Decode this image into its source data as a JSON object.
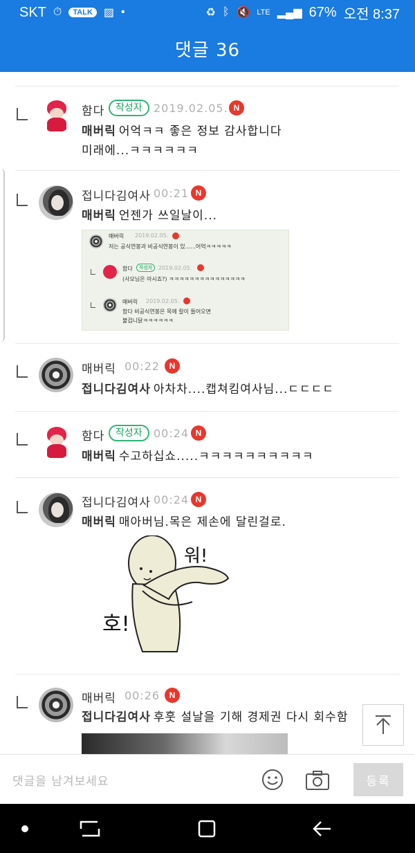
{
  "status_bar": {
    "carrier": "SKT",
    "talk_label": "TALK",
    "network": "LTE",
    "battery": "67%",
    "time": "오전 8:37"
  },
  "header": {
    "title": "댓글 36"
  },
  "comments": [
    {
      "author": "함다",
      "badge": "작성자",
      "time": "2019.02.05.",
      "new_label": "N",
      "mention": "매버릭",
      "text_line1": "어억ㅋㅋ 좋은 정보 감사합니다",
      "text_line2": "미래에...ㅋㅋㅋㅋㅋㅋ"
    },
    {
      "author": "접니다김여사",
      "time": "00:21",
      "new_label": "N",
      "mention": "매버릭",
      "text_line1": "언젠가 쓰일날이..."
    },
    {
      "author": "매버릭",
      "time": "00:22",
      "new_label": "N",
      "mention": "접니다김여사",
      "text_line1": "아차차....캡쳐킴여사님...ㄷㄷㄷㄷ"
    },
    {
      "author": "함다",
      "badge": "작성자",
      "time": "00:24",
      "new_label": "N",
      "mention": "매버릭",
      "text_line1": "수고하십쇼.....ㅋㅋㅋㅋㅋㅋㅋㅋㅋㅋ"
    },
    {
      "author": "접니다김여사",
      "time": "00:24",
      "new_label": "N",
      "mention": "매버릭",
      "text_line1": "매아버님.목은 제손에 달린걸로."
    },
    {
      "author": "매버릭",
      "time": "00:26",
      "new_label": "N",
      "mention": "접니다김여사",
      "text_line1": "후훗 설날을 기해 경제권 다시 회수함"
    }
  ],
  "embed": {
    "r1_author": "매버릭",
    "r1_time": "2019.02.05.",
    "r1_text": "저는 공식연봉과 비공식연봉이 있......어억ㅋㅋㅋㅋㅋ",
    "r2_author": "함다",
    "r2_badge": "작성자",
    "r2_time": "2019.02.05.",
    "r2_text": "(사모님은 아시죠?) ㅋㅋㅋㅋㅋㅋㅋㅋㅋㅋㅋㅋㅋㅋㅋ",
    "r3_author": "매버릭",
    "r3_time": "2019.02.05.",
    "r3_text1": "함다 비공식연봉은 목에 칼이 들어오면",
    "r3_text2": "불겁니닭ㅋㅋㅋㅋㅋㅋ"
  },
  "sticker": {
    "text_top": "워!",
    "text_left": "호!"
  },
  "input": {
    "placeholder": "댓글을 남겨보세요",
    "submit_label": "등록"
  },
  "icons": {
    "emoji": "smiley-icon",
    "camera": "camera-icon",
    "scroll_top": "arrow-up-to-top-icon"
  },
  "colors": {
    "header_bg": "#1a7be0",
    "badge_green": "#2bb673",
    "new_red": "#e8372c"
  }
}
